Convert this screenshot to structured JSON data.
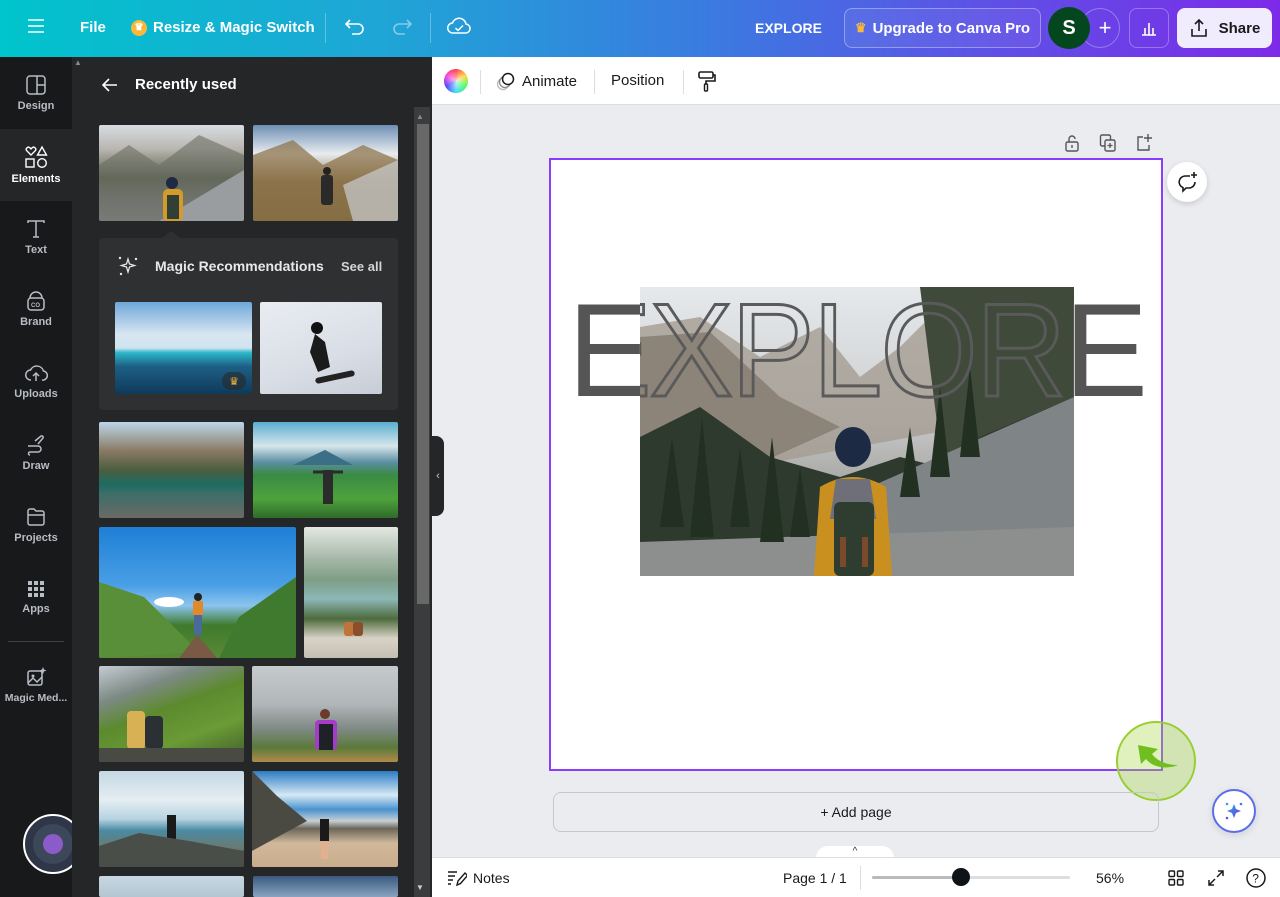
{
  "topbar": {
    "menu_icon": "hamburger-icon",
    "file": "File",
    "resize": "Resize & Magic Switch",
    "design_title": "EXPLORE",
    "upgrade": "Upgrade to Canva Pro",
    "avatar_initial": "S",
    "share": "Share"
  },
  "rail": {
    "items": [
      {
        "label": "Design",
        "icon": "layout-icon"
      },
      {
        "label": "Elements",
        "icon": "shapes-icon",
        "active": true
      },
      {
        "label": "Text",
        "icon": "text-icon"
      },
      {
        "label": "Brand",
        "icon": "brand-icon"
      },
      {
        "label": "Uploads",
        "icon": "cloud-upload-icon"
      },
      {
        "label": "Draw",
        "icon": "draw-icon"
      },
      {
        "label": "Projects",
        "icon": "folder-icon"
      },
      {
        "label": "Apps",
        "icon": "grid-icon"
      },
      {
        "label": "Magic Med...",
        "icon": "magic-media-icon"
      }
    ]
  },
  "panel": {
    "title": "Recently used",
    "magic": {
      "title": "Magic Recommendations",
      "see_all": "See all"
    },
    "thumbnails": [
      "hiker-yellow-jacket-rocks",
      "hiker-mountain-valley",
      "ocean-coastline",
      "snowboarder",
      "couple-mountain-lake",
      "hiker-green-hills-volcano",
      "hiker-blue-sky-peak",
      "couple-cliff-canyon-lake",
      "couple-green-mountainside",
      "hiker-purple-jacket-fog",
      "hiker-above-clouds",
      "hiker-dirt-road-snowy-peaks"
    ]
  },
  "context_toolbar": {
    "animate": "Animate",
    "position": "Position"
  },
  "canvas": {
    "headline": "EXPLORE",
    "selection_color": "#8b3dff"
  },
  "add_page": "+ Add page",
  "footer": {
    "notes": "Notes",
    "page": "Page 1 / 1",
    "zoom_percent": 56,
    "zoom_label": "56%"
  },
  "colors": {
    "brand_purple": "#7d2ae8",
    "brand_teal": "#00c4cc",
    "crown": "#f9b83a",
    "avatar_bg": "#04461e"
  }
}
